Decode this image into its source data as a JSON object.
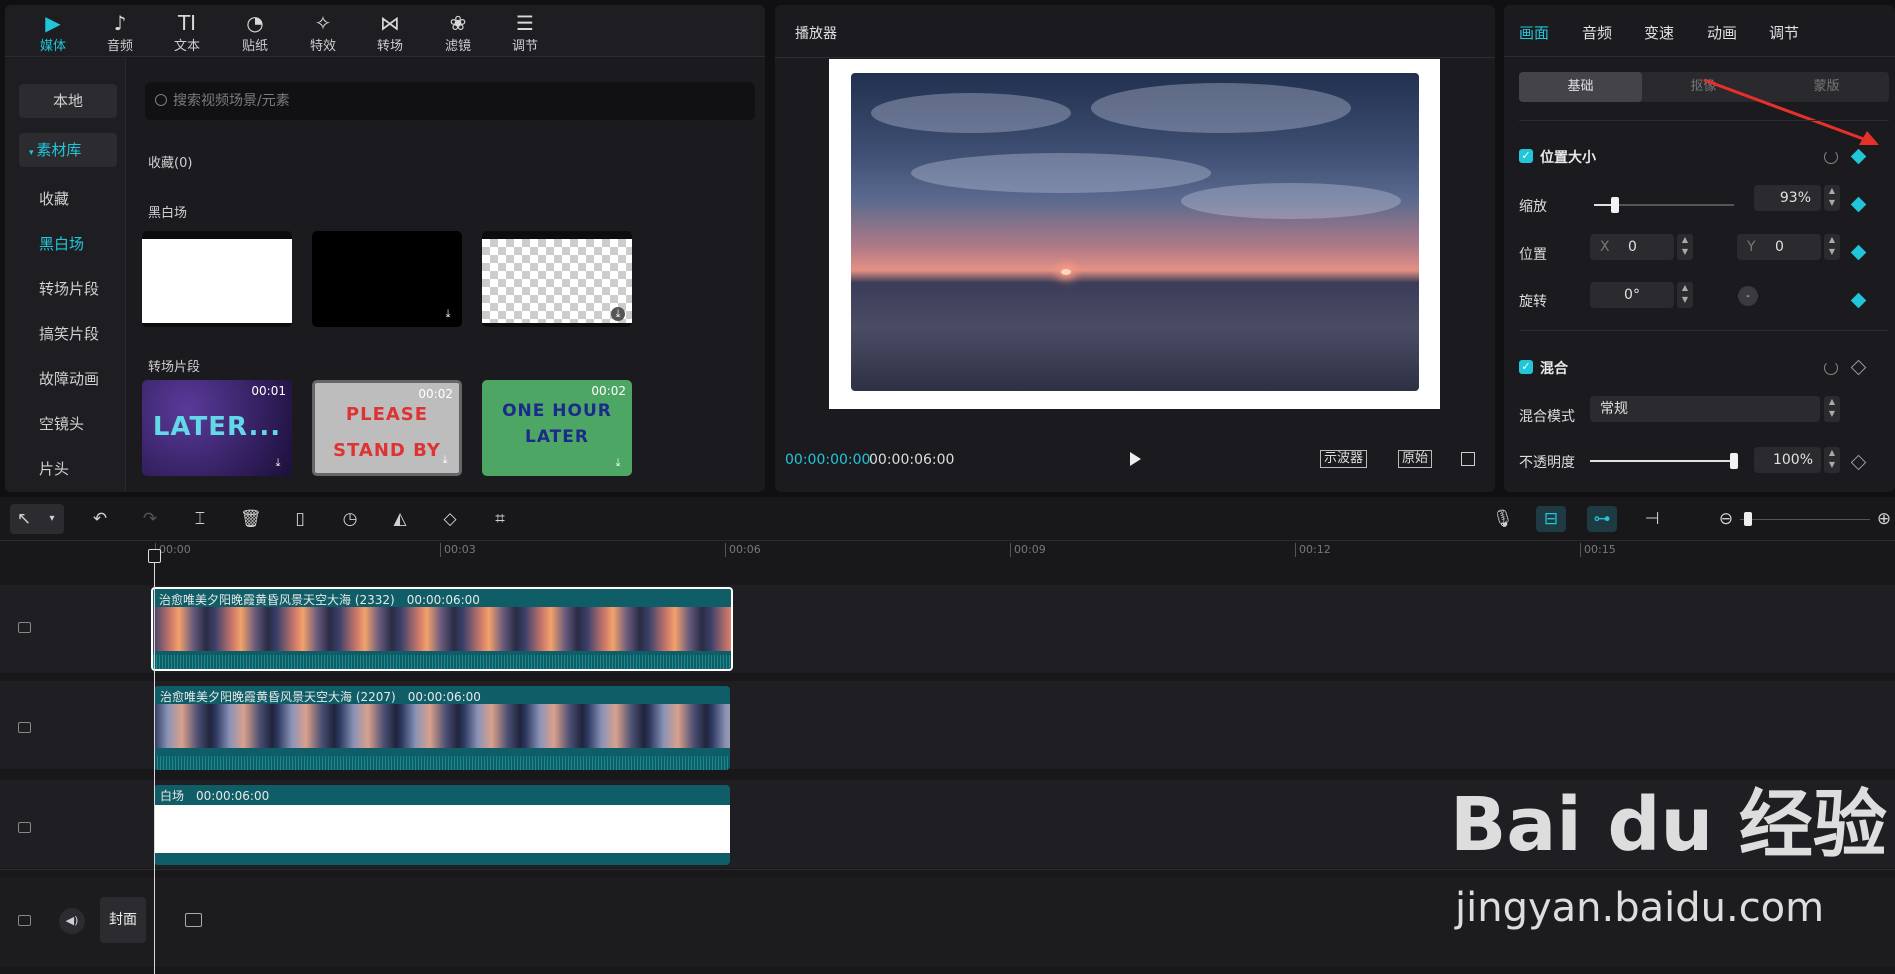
{
  "media_tabs": [
    {
      "label": "媒体",
      "icon": "media-icon"
    },
    {
      "label": "音频",
      "icon": "audio-icon"
    },
    {
      "label": "文本",
      "icon": "text-icon"
    },
    {
      "label": "贴纸",
      "icon": "sticker-icon"
    },
    {
      "label": "特效",
      "icon": "effects-icon"
    },
    {
      "label": "转场",
      "icon": "transition-icon"
    },
    {
      "label": "滤镜",
      "icon": "filter-icon"
    },
    {
      "label": "调节",
      "icon": "adjust-icon"
    }
  ],
  "left_nav": {
    "local": "本地",
    "library": "素材库",
    "items": [
      "收藏",
      "黑白场",
      "转场片段",
      "搞笑片段",
      "故障动画",
      "空镜头",
      "片头"
    ]
  },
  "search": {
    "placeholder": "搜索视频场景/元素"
  },
  "sections": {
    "favorites": "收藏(0)",
    "black_white": "黑白场",
    "transition_clips": "转场片段"
  },
  "clip_thumbs": [
    {
      "duration": "00:01",
      "text": "LATER..."
    },
    {
      "duration": "00:02",
      "text": "PLEASE STAND BY"
    },
    {
      "duration": "00:02",
      "text": "ONE HOUR LATER"
    }
  ],
  "player": {
    "title": "播放器",
    "current_time": "00:00:00:00",
    "total_time": "00:00:06:00",
    "scope_btn": "示波器",
    "original_btn": "原始"
  },
  "props": {
    "tabs": [
      "画面",
      "音频",
      "变速",
      "动画",
      "调节"
    ],
    "sub_tabs": [
      "基础",
      "抠像",
      "蒙版"
    ],
    "position_size": "位置大小",
    "scale_label": "缩放",
    "scale_value": "93%",
    "scale_level": 0.93,
    "position_label": "位置",
    "x_label": "X",
    "x_value": "0",
    "y_label": "Y",
    "y_value": "0",
    "rotate_label": "旋转",
    "rotate_value": "0°",
    "blend": "混合",
    "blend_mode_label": "混合模式",
    "blend_mode_value": "常规",
    "opacity_label": "不透明度",
    "opacity_value": "100%",
    "opacity_level": 1.0
  },
  "timeline": {
    "ruler": [
      "00:00",
      "00:03",
      "00:06",
      "00:09",
      "00:12",
      "00:15"
    ],
    "clips": [
      {
        "name": "治愈唯美夕阳晚霞黄昏风景天空大海 (2332)",
        "duration": "00:00:06:00"
      },
      {
        "name": "治愈唯美夕阳晚霞黄昏风景天空大海 (2207)",
        "duration": "00:00:06:00"
      },
      {
        "name": "白场",
        "duration": "00:00:06:00"
      }
    ],
    "cover_label": "封面"
  },
  "watermark": {
    "line1": "Bai du 经验",
    "line2": "jingyan.baidu.com"
  },
  "colors": {
    "accent": "#21c6d8",
    "panel": "#1b1b1f"
  }
}
